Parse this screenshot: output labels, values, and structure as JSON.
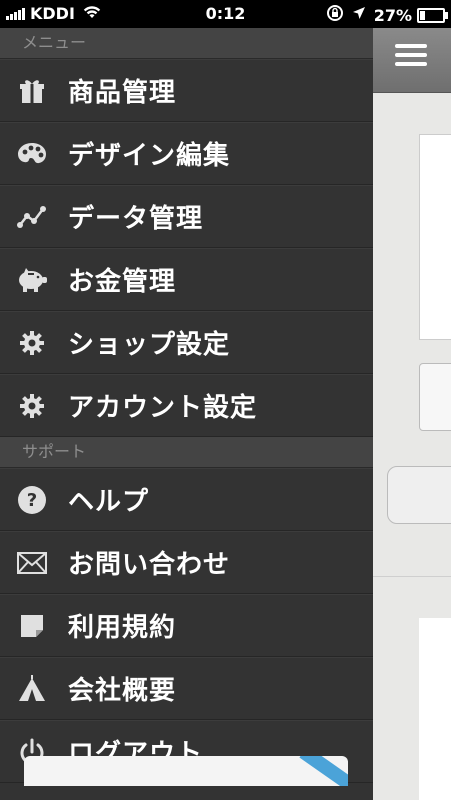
{
  "status_bar": {
    "carrier": "KDDI",
    "time": "0:12",
    "battery_percent": "27%",
    "battery_level": 0.27
  },
  "menu": {
    "section_title": "メニュー",
    "items": [
      {
        "label": "商品管理",
        "icon": "gift-icon"
      },
      {
        "label": "デザイン編集",
        "icon": "palette-icon"
      },
      {
        "label": "データ管理",
        "icon": "chart-line-icon"
      },
      {
        "label": "お金管理",
        "icon": "piggy-bank-icon"
      },
      {
        "label": "ショップ設定",
        "icon": "gear-icon"
      },
      {
        "label": "アカウント設定",
        "icon": "gear-icon"
      }
    ]
  },
  "support": {
    "section_title": "サポート",
    "items": [
      {
        "label": "ヘルプ",
        "icon": "help-icon"
      },
      {
        "label": "お問い合わせ",
        "icon": "envelope-icon"
      },
      {
        "label": "利用規約",
        "icon": "note-icon"
      },
      {
        "label": "会社概要",
        "icon": "tent-icon"
      },
      {
        "label": "ログアウト",
        "icon": "power-icon"
      }
    ]
  },
  "colors": {
    "menu_bg": "#333333",
    "section_bg": "#444444",
    "text": "#ffffff",
    "section_text": "#8e8e8e",
    "icon": "#e0e0e0",
    "accent_ribbon": "#4ba3d8"
  }
}
